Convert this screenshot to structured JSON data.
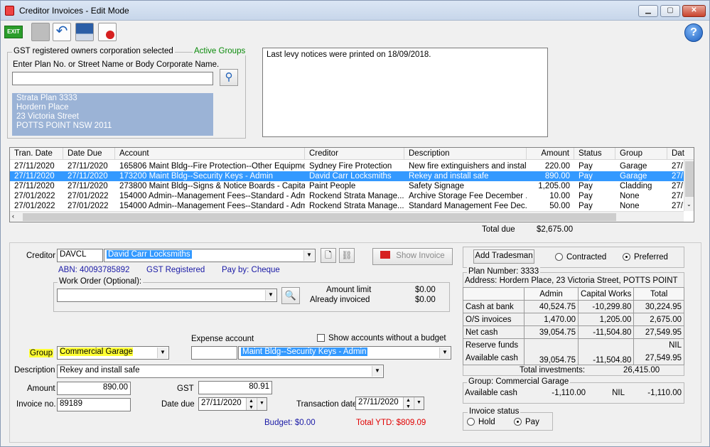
{
  "window": {
    "title": "Creditor Invoices - Edit Mode",
    "exit_label": "EXIT",
    "help_label": "?"
  },
  "gst_group": {
    "legend": "GST registered owners corporation selected",
    "active_groups": "Active Groups",
    "prompt": "Enter Plan No. or Street Name or Body Corporate Name.",
    "search_value": "",
    "address": [
      "Strata Plan 3333",
      "Hordern Place",
      "23 Victoria Street",
      "POTTS POINT  NSW  2011"
    ]
  },
  "notes": "Last levy notices were printed on 18/09/2018.",
  "grid": {
    "columns": [
      "Tran. Date",
      "Date Due",
      "Account",
      "Creditor",
      "Description",
      "Amount",
      "Status",
      "Group",
      "Dat"
    ],
    "rows": [
      [
        "27/11/2020",
        "27/11/2020",
        "165806  Maint Bldg--Fire Protection--Other Equipme...",
        "Sydney Fire Protection",
        "New fire extinguishers and instal...",
        "220.00",
        "Pay",
        "Garage",
        "27/"
      ],
      [
        "27/11/2020",
        "27/11/2020",
        "173200  Maint Bldg--Security Keys - Admin",
        "David Carr Locksmiths",
        "Rekey and install safe",
        "890.00",
        "Pay",
        "Garage",
        "27/"
      ],
      [
        "27/11/2020",
        "27/11/2020",
        "273800  Maint Bldg--Signs & Notice Boards - Capital...",
        "Paint People",
        "Safety Signage",
        "1,205.00",
        "Pay",
        "Cladding",
        "27/"
      ],
      [
        "27/01/2022",
        "27/01/2022",
        "154000  Admin--Management Fees--Standard - Admin",
        "Rockend Strata Manage...",
        "Archive Storage Fee December ...",
        "10.00",
        "Pay",
        "None",
        "27/"
      ],
      [
        "27/01/2022",
        "27/01/2022",
        "154000  Admin--Management Fees--Standard - Admin",
        "Rockend Strata Manage...",
        "Standard Management Fee Dec...",
        "50.00",
        "Pay",
        "None",
        "27/"
      ]
    ],
    "selected_row": 1,
    "total_label": "Total due",
    "total_value": "$2,675.00"
  },
  "form": {
    "creditor_label": "Creditor",
    "creditor_code": "DAVCL",
    "creditor_name": "David Carr Locksmiths",
    "show_invoice": "Show Invoice",
    "abn": "ABN: 40093785892",
    "gst_registered": "GST Registered",
    "pay_by": "Pay by: Cheque",
    "work_order_legend": "Work Order (Optional):",
    "work_order_value": "",
    "amount_limit_label": "Amount limit",
    "amount_limit_value": "$0.00",
    "already_invoiced_label": "Already invoiced",
    "already_invoiced_value": "$0.00",
    "expense_account_label": "Expense account",
    "show_accounts_label": "Show accounts without a budget",
    "group_label": "Group",
    "group_value": "Commercial Garage",
    "expense_code": "",
    "expense_account_value": "Maint Bldg--Security Keys - Admin",
    "description_label": "Description",
    "description_value": "Rekey and install safe",
    "amount_label": "Amount",
    "amount_value": "890.00",
    "gst_label": "GST",
    "gst_value": "80.91",
    "invoice_label": "Invoice no.",
    "invoice_value": "89189",
    "date_due_label": "Date due",
    "date_due_value": "27/11/2020",
    "transaction_date_label": "Transaction date",
    "transaction_date_value": "27/11/2020",
    "budget": "Budget: $0.00",
    "total_ytd": "Total YTD: $809.09"
  },
  "tradesman": {
    "add_label": "Add Tradesman",
    "contracted": "Contracted",
    "preferred": "Preferred"
  },
  "plan": {
    "number": "Plan Number: 3333",
    "address": "Address: Hordern Place, 23 Victoria Street, POTTS POINT",
    "headers": [
      "Admin",
      "Capital Works",
      "Total"
    ],
    "rows": [
      [
        "Cash at bank",
        "40,524.75",
        "-10,299.80",
        "30,224.95"
      ],
      [
        "O/S invoices",
        "1,470.00",
        "1,205.00",
        "2,675.00"
      ],
      [
        "Net cash",
        "39,054.75",
        "-11,504.80",
        "27,549.95"
      ]
    ],
    "reserve_label": "Reserve funds",
    "reserve_value": "NIL",
    "available_label": "Available cash",
    "available_values": [
      "39,054.75",
      "-11,504.80",
      "27,549.95"
    ],
    "total_investments_label": "Total investments:",
    "total_investments_value": "26,415.00"
  },
  "group_box": {
    "legend": "Group: Commercial Garage",
    "available_label": "Available cash",
    "col1": "-1,110.00",
    "col2": "NIL",
    "col3": "-1,110.00"
  },
  "invoice_status": {
    "legend": "Invoice status",
    "hold": "Hold",
    "pay": "Pay"
  },
  "colors": {
    "selection": "#3399ff",
    "address_bg": "#9bb3d6",
    "highlight": "#ffff33",
    "ytd": "#e00000"
  }
}
